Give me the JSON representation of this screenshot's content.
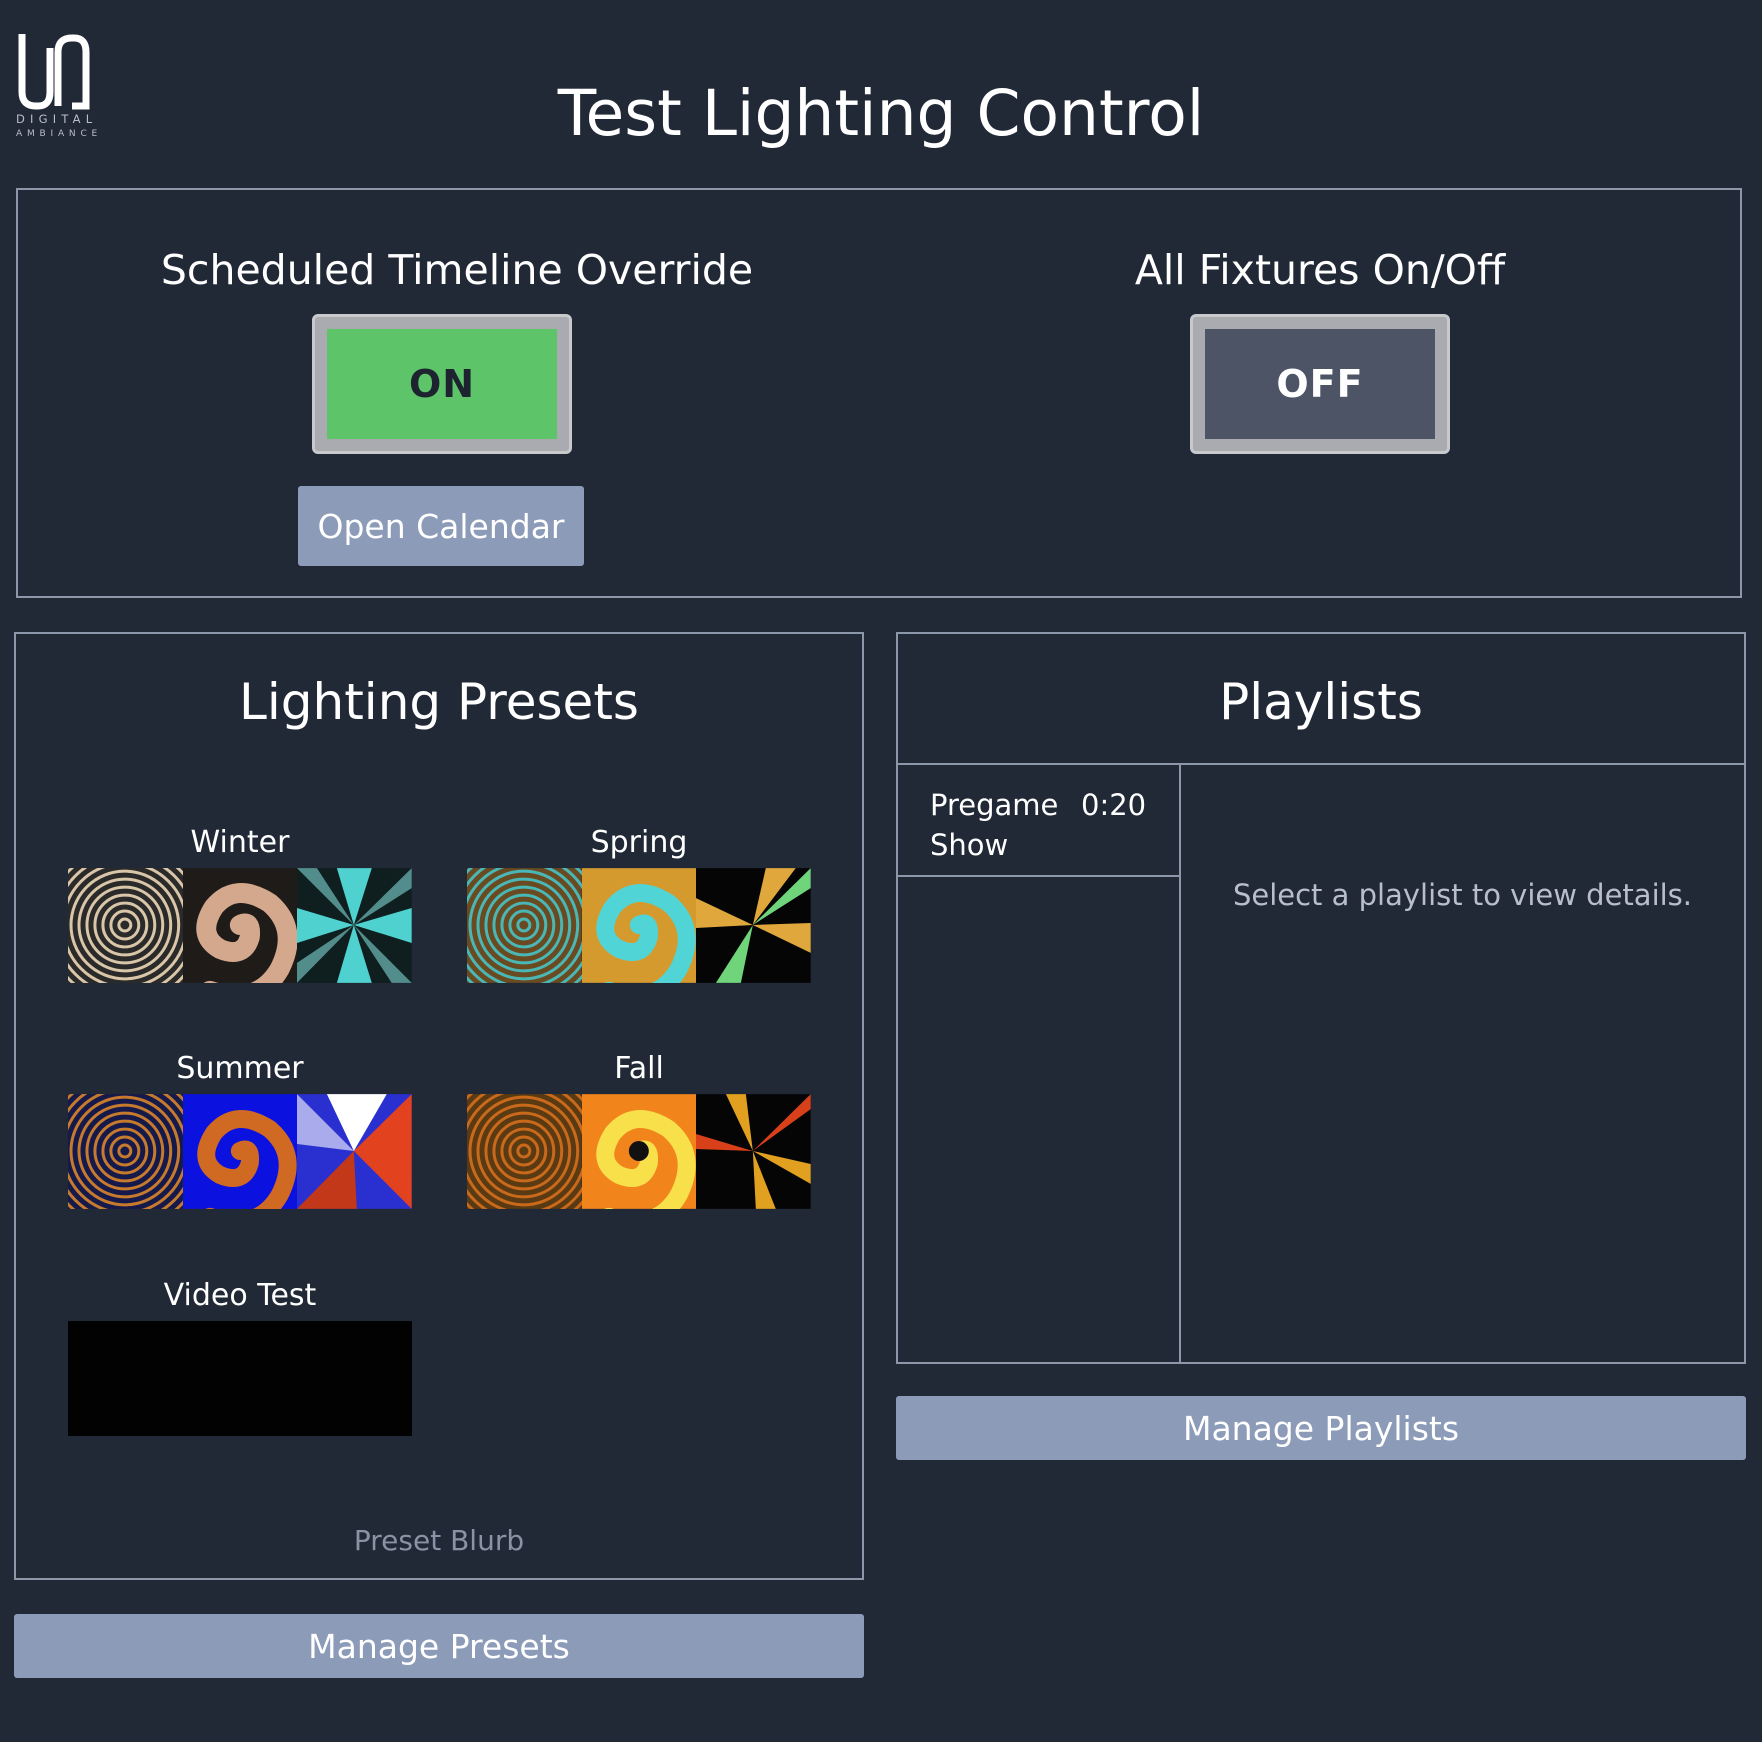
{
  "logo": {
    "icon": "da-monogram-logo",
    "line1": "DIGITAL",
    "line2": "AMBIANCE"
  },
  "page_title": "Test Lighting Control",
  "override": {
    "title": "Scheduled Timeline Override",
    "state_label": "ON",
    "state_color": "#5ec46a",
    "calendar_button": "Open Calendar"
  },
  "fixtures": {
    "title": "All Fixtures On/Off",
    "state_label": "OFF",
    "state_color": "#4c5466"
  },
  "presets": {
    "title": "Lighting Presets",
    "items": [
      {
        "name": "Winter",
        "thumbnails": [
          "concentric-rings",
          "spiral",
          "radial-beams"
        ],
        "colors": [
          "#d9c5a8",
          "#e7b89a",
          "#4fd1cf"
        ]
      },
      {
        "name": "Spring",
        "thumbnails": [
          "concentric-rings",
          "spiral",
          "radial-beams"
        ],
        "colors": [
          "#4ab7b7",
          "#50d4d6",
          "#e0a83c"
        ]
      },
      {
        "name": "Summer",
        "thumbnails": [
          "concentric-rings",
          "spiral",
          "radial-beams"
        ],
        "colors": [
          "#c57a2e",
          "#0b12e0",
          "#e2421e"
        ]
      },
      {
        "name": "Fall",
        "thumbnails": [
          "concentric-rings",
          "spiral",
          "radial-beams"
        ],
        "colors": [
          "#c8691c",
          "#f2841c",
          "#e2a020"
        ]
      },
      {
        "name": "Video Test",
        "thumbnails": [
          "video-black"
        ],
        "colors": [
          "#020202"
        ]
      }
    ],
    "blurb": "Preset Blurb",
    "manage_button": "Manage Presets"
  },
  "playlists": {
    "title": "Playlists",
    "items": [
      {
        "name": "Pregame Show",
        "duration": "0:20"
      }
    ],
    "detail_placeholder": "Select a playlist to view details.",
    "manage_button": "Manage Playlists"
  }
}
